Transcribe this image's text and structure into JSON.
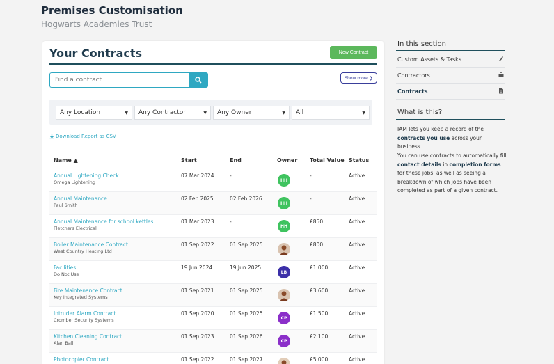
{
  "header": {
    "title": "Premises Customisation",
    "subtitle": "Hogwarts Academies Trust"
  },
  "card": {
    "title": "Your Contracts",
    "new_button": "New Contract",
    "search_placeholder": "Find a contract",
    "show_more": "Show more ❯",
    "filters": [
      {
        "value": "Any Location"
      },
      {
        "value": "Any Contractor"
      },
      {
        "value": "Any Owner"
      },
      {
        "value": "All"
      }
    ],
    "download_label": "Download Report as CSV"
  },
  "table": {
    "headers": {
      "name": "Name ▲",
      "start": "Start",
      "end": "End",
      "owner": "Owner",
      "value": "Total Value",
      "status": "Status"
    },
    "rows": [
      {
        "name": "Annual Lightening Check",
        "contractor": "Omega Lightening",
        "start": "07 Mar 2024",
        "end": "-",
        "owner": "HH",
        "owner_color": "#3fc35f",
        "value": "-",
        "status": "Active"
      },
      {
        "name": "Annual Maintenance",
        "contractor": "Paul Smith",
        "start": "02 Feb 2025",
        "end": "02 Feb 2026",
        "owner": "HH",
        "owner_color": "#3fc35f",
        "value": "-",
        "status": "Active"
      },
      {
        "name": "Annual Maintenance for school kettles",
        "contractor": "Fletchers Electrical",
        "start": "01 Mar 2023",
        "end": "-",
        "owner": "HH",
        "owner_color": "#3fc35f",
        "value": "£850",
        "status": "Active"
      },
      {
        "name": "Boiler Maintenance Contract",
        "contractor": "West Country Heating Ltd",
        "start": "01 Sep 2022",
        "end": "01 Sep 2025",
        "owner": "",
        "owner_color": "photo",
        "value": "£800",
        "status": "Active"
      },
      {
        "name": "Facilities",
        "contractor": "Do Not Use",
        "start": "19 Jun 2024",
        "end": "19 Jun 2025",
        "owner": "LB",
        "owner_color": "#3b2fa8",
        "value": "£1,000",
        "status": "Active"
      },
      {
        "name": "Fire Maintenance Contract",
        "contractor": "Key Integrated Systems",
        "start": "01 Sep 2021",
        "end": "01 Sep 2025",
        "owner": "",
        "owner_color": "photo",
        "value": "£3,600",
        "status": "Active"
      },
      {
        "name": "Intruder Alarm Contract",
        "contractor": "Cromber Security Systems",
        "start": "01 Sep 2020",
        "end": "01 Sep 2025",
        "owner": "CP",
        "owner_color": "#8b2fc9",
        "value": "£1,500",
        "status": "Active"
      },
      {
        "name": "Kitchen Cleaning Contract",
        "contractor": "Alan Ball",
        "start": "01 Sep 2023",
        "end": "01 Sep 2026",
        "owner": "CP",
        "owner_color": "#8b2fc9",
        "value": "£2,100",
        "status": "Active"
      },
      {
        "name": "Photocopier Contract",
        "contractor": "",
        "start": "01 Sep 2022",
        "end": "01 Sep 2027",
        "owner": "",
        "owner_color": "photo2",
        "value": "£5,000",
        "status": "Active"
      }
    ]
  },
  "sidebar": {
    "section_title": "In this section",
    "items": [
      {
        "label": "Custom Assets & Tasks",
        "icon": "wrench-icon"
      },
      {
        "label": "Contractors",
        "icon": "toolbox-icon"
      },
      {
        "label": "Contracts",
        "icon": "document-icon"
      }
    ],
    "info_title": "What is this?",
    "info_p1_a": "IAM lets you keep a record of the ",
    "info_p1_b": "contracts you use",
    "info_p1_c": " across your business.",
    "info_p2_a": "You can use contracts to automatically fill ",
    "info_p2_b": "contact details",
    "info_p2_c": " in ",
    "info_p2_d": "completion forms",
    "info_p2_e": " for these jobs, as well as seeing a breakdown of which jobs have been completed as part of a given contract."
  }
}
